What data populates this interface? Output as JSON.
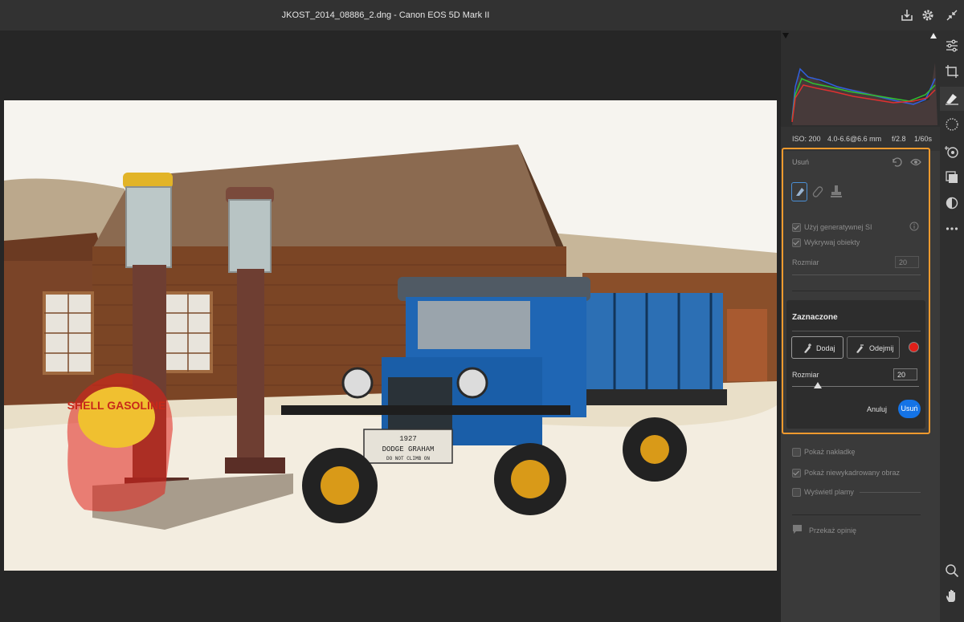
{
  "window": {
    "title": "JKOST_2014_08886_2.dng  -  Canon EOS 5D Mark II"
  },
  "exif": {
    "iso": "ISO: 200",
    "lens": "4.0-6.6@6.6 mm",
    "aperture": "f/2.8",
    "shutter": "1/60s"
  },
  "remove": {
    "title": "Usuń",
    "use_genai": "Użyj generatywnej SI",
    "detect_objects": "Wykrywaj obiekty",
    "size_label": "Rozmiar",
    "size_value": "20"
  },
  "selected": {
    "title": "Zaznaczone",
    "add": "Dodaj",
    "subtract": "Odejmij",
    "size_label": "Rozmiar",
    "size_value": "20",
    "size_level": 0.2,
    "cancel": "Anuluj",
    "apply": "Usuń",
    "overlay_color": "#e0201a"
  },
  "options": {
    "show_overlay": "Pokaż nakładkę",
    "show_uncropped": "Pokaż niewykadrowany obraz",
    "show_spots": "Wyświetl plamy",
    "feedback": "Przekaż opinię"
  },
  "photo": {
    "pump_sign": "SHELL GASOLINE",
    "plate_line1": "1927",
    "plate_line2": "DODGE GRAHAM",
    "plate_line3": "DO NOT CLIMB ON"
  },
  "colors": {
    "accent": "#f29a2e",
    "primary": "#1473e6",
    "brush_color": "#e0201a"
  }
}
